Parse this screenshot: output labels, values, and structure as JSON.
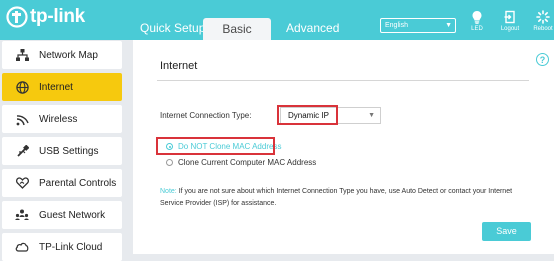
{
  "header": {
    "brand": "tp-link",
    "tabs": [
      {
        "label": "Quick Setup"
      },
      {
        "label": "Basic"
      },
      {
        "label": "Advanced"
      }
    ],
    "language": {
      "value": "English"
    },
    "buttons": [
      {
        "label": "LED",
        "icon": "bulb-icon"
      },
      {
        "label": "Logout",
        "icon": "logout-icon"
      },
      {
        "label": "Reboot",
        "icon": "reboot-icon"
      }
    ]
  },
  "sidebar": {
    "items": [
      {
        "label": "Network Map",
        "icon": "network-map-icon"
      },
      {
        "label": "Internet",
        "icon": "globe-icon",
        "active": true
      },
      {
        "label": "Wireless",
        "icon": "wireless-icon"
      },
      {
        "label": "USB Settings",
        "icon": "usb-icon"
      },
      {
        "label": "Parental Controls",
        "icon": "parental-controls-icon"
      },
      {
        "label": "Guest Network",
        "icon": "guest-network-icon"
      },
      {
        "label": "TP-Link Cloud",
        "icon": "cloud-icon"
      }
    ]
  },
  "main": {
    "help_icon": "?",
    "title": "Internet",
    "connection_type_label": "Internet Connection Type:",
    "connection_type_value": "Dynamic IP",
    "mac_options": [
      {
        "label": "Do NOT Clone MAC Address",
        "checked": true
      },
      {
        "label": "Clone Current Computer MAC Address",
        "checked": false
      }
    ],
    "note_prefix": "Note:",
    "note_text": "If you are not sure about which Internet Connection Type you have, use Auto Detect or contact your Internet Service Provider (ISP) for assistance.",
    "save_label": "Save"
  },
  "colors": {
    "accent": "#4acbd6",
    "active": "#f6c90e",
    "highlight": "#d9333a"
  }
}
